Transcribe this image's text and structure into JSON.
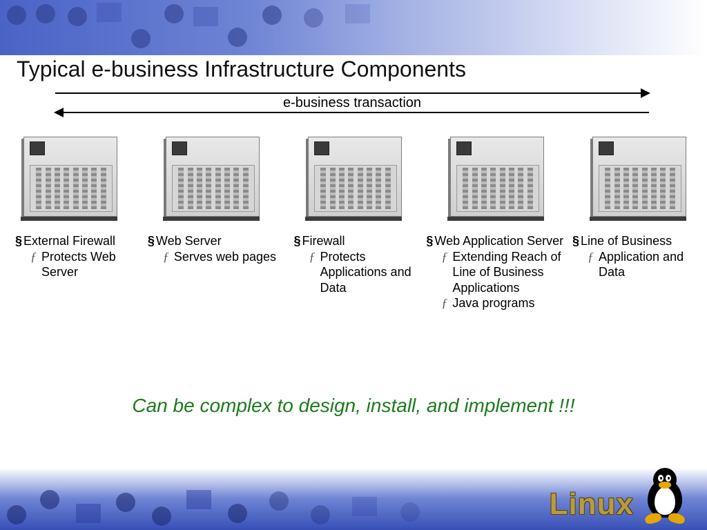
{
  "title": "Typical e-business Infrastructure Components",
  "arrow_label": "e-business transaction",
  "columns": [
    {
      "title": "External Firewall",
      "subs": [
        "Protects Web Server"
      ]
    },
    {
      "title": "Web Server",
      "subs": [
        "Serves web pages"
      ]
    },
    {
      "title": "Firewall",
      "subs": [
        "Protects Applications and Data"
      ]
    },
    {
      "title": "Web Application Server",
      "subs": [
        "Extending Reach of Line of Business Applications",
        "Java programs"
      ]
    },
    {
      "title": "Line of Business",
      "subs": [
        "Application and Data"
      ]
    }
  ],
  "conclusion": "Can be complex to design, install, and implement !!!",
  "brand": "Linux",
  "bullet_char": "§",
  "sub_char": "ƒ"
}
